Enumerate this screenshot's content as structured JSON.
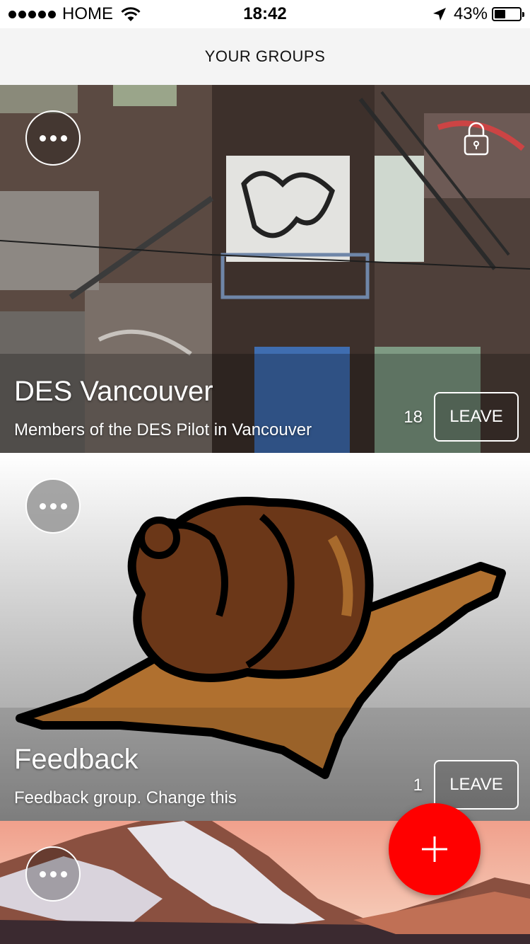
{
  "status_bar": {
    "carrier": "HOME",
    "time": "18:42",
    "battery": "43%",
    "battery_level": 0.43,
    "signal_bars": 5
  },
  "header": {
    "title": "YOUR GROUPS"
  },
  "groups": [
    {
      "name": "DES Vancouver",
      "description": "Members of the DES Pilot in Vancouver",
      "member_count": "18",
      "leave_label": "LEAVE",
      "locked": true
    },
    {
      "name": "Feedback",
      "description": "Feedback group. Change this",
      "member_count": "1",
      "leave_label": "LEAVE",
      "locked": false
    },
    {
      "name": "",
      "description": "",
      "member_count": "",
      "leave_label": "",
      "locked": false
    }
  ],
  "fab": {
    "icon": "plus-icon",
    "color": "#ff0000"
  },
  "colors": {
    "accent": "#ff0000",
    "header_bg": "#f4f4f4"
  }
}
